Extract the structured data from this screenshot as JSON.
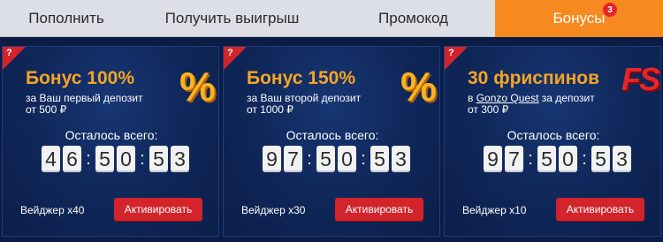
{
  "tabs": [
    {
      "label": "Пополнить"
    },
    {
      "label": "Получить выигрыш"
    },
    {
      "label": "Промокод"
    },
    {
      "label": "Бонусы",
      "badge": "3",
      "active": true
    }
  ],
  "colors": {
    "accent": "#f6891f",
    "button": "#d2242a",
    "title": "#f7a426",
    "background": "#0b1d45"
  },
  "cards": [
    {
      "help": "?",
      "title": "Бонус 100%",
      "desc_line1": "за Ваш первый депозит",
      "desc_line2": "от 500 ₽",
      "icon_text": "%",
      "icon": "percent-icon",
      "remain_label": "Осталось всего:",
      "digits": [
        "4",
        "6",
        "5",
        "0",
        "5",
        "3"
      ],
      "colon": ":",
      "wager": "Вейджер х40",
      "button": "Активировать"
    },
    {
      "help": "?",
      "title": "Бонус 150%",
      "desc_line1": "за Ваш второй депозит",
      "desc_line2": "от 1000 ₽",
      "icon_text": "%",
      "icon": "percent-icon",
      "remain_label": "Осталось всего:",
      "digits": [
        "9",
        "7",
        "5",
        "0",
        "5",
        "3"
      ],
      "colon": ":",
      "wager": "Вейджер х30",
      "button": "Активировать"
    },
    {
      "help": "?",
      "title": "30 фриспинов",
      "desc_prefix": "в",
      "desc_link": "Gonzo Quest",
      "desc_suffix": "за депозит",
      "desc_line2": "от 300 ₽",
      "icon_text": "FS",
      "icon": "freespins-icon",
      "remain_label": "Осталось всего:",
      "digits": [
        "9",
        "7",
        "5",
        "0",
        "5",
        "3"
      ],
      "colon": ":",
      "wager": "Вейджер х10",
      "button": "Активировать"
    }
  ]
}
